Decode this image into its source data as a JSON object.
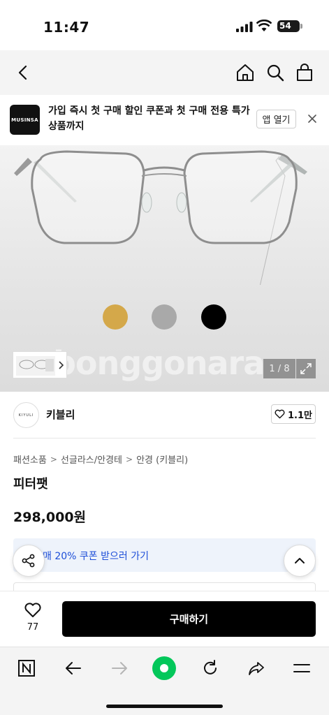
{
  "status": {
    "time": "11:47",
    "battery": "54"
  },
  "banner": {
    "logo_text": "MUSINSA",
    "text": "가입 즉시 첫 구매 할인 쿠폰과 첫 구매 전용 특가 상품까지",
    "open_label": "앱 열기"
  },
  "hero": {
    "watermark": "bonggonara",
    "counter": "1 / 8",
    "swatches": [
      "#d4a84a",
      "#a9a9a9",
      "#000000"
    ]
  },
  "brand": {
    "logo_text": "KIYULI",
    "name": "키블리",
    "like_count": "1.1만"
  },
  "breadcrumb": [
    "패션소품",
    "선글라스/안경테",
    "안경 (키블리)"
  ],
  "product": {
    "title": "피터팻",
    "price": "298,000원"
  },
  "coupon": {
    "text": "매 20% 쿠폰 받으러 가기"
  },
  "buybar": {
    "likes": "77",
    "buy_label": "구매하기"
  },
  "colors": {
    "accent": "#1d4ed8",
    "naver_green": "#03c75a"
  }
}
